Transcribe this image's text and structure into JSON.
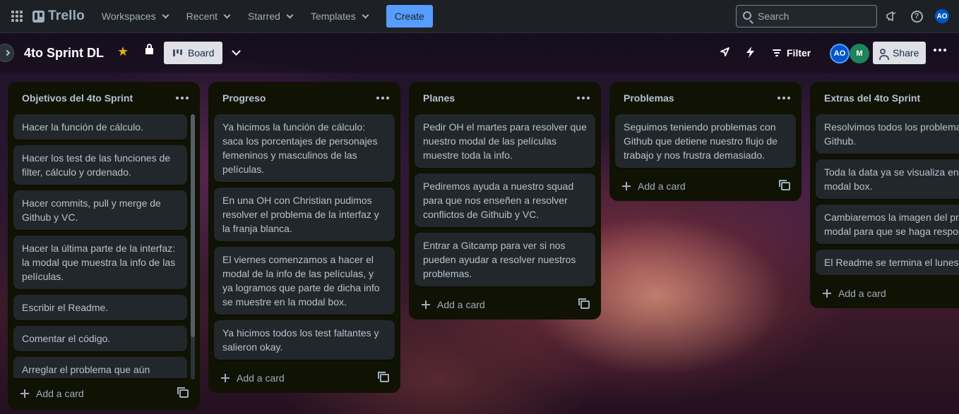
{
  "topbar": {
    "logo_text": "Trello",
    "nav": [
      "Workspaces",
      "Recent",
      "Starred",
      "Templates"
    ],
    "create_label": "Create",
    "search_placeholder": "Search",
    "user_initials": "AO"
  },
  "board": {
    "title": "4to Sprint DL",
    "view_label": "Board",
    "filter_label": "Filter",
    "members": [
      "AO",
      "M"
    ],
    "share_label": "Share"
  },
  "lists": [
    {
      "title": "Objetivos del 4to Sprint",
      "cards": [
        "Hacer la función de cálculo.",
        "Hacer los test de las funciones de filter, cálculo y ordenado.",
        "Hacer commits, pull y merge de Github y VC.",
        "Hacer la última parte de la interfaz: la modal que muestra la info de las películas.",
        "Escribir el Readme.",
        "Comentar el código.",
        "Arreglar el problema que aún"
      ],
      "add_label": "Add a card"
    },
    {
      "title": "Progreso",
      "cards": [
        "Ya hicimos la función de cálculo: saca los porcentajes de personajes femeninos y masculinos de las películas.",
        "En una OH con Christian pudimos resolver el problema de la interfaz y la franja blanca.",
        "El viernes comenzamos a hacer el modal de la info de las películas, y ya logramos que parte de dicha info se muestre en la modal box.",
        "Ya hicimos todos los test faltantes y salieron okay."
      ],
      "add_label": "Add a card"
    },
    {
      "title": "Planes",
      "cards": [
        "Pedir OH el martes para resolver que nuestro modal de las películas muestre toda la info.",
        "Pediremos ayuda a nuestro squad para que nos enseñen a resolver conflictos de Githuib y VC.",
        "Entrar a Gitcamp para ver si nos pueden ayudar a resolver nuestros problemas."
      ],
      "add_label": "Add a card"
    },
    {
      "title": "Problemas",
      "cards": [
        "Seguimos teniendo problemas con Github que detiene nuestro flujo de trabajo y nos frustra demasiado."
      ],
      "add_label": "Add a card"
    },
    {
      "title": "Extras del 4to Sprint",
      "cards": [
        "Resolvimos todos los problema Github.",
        "Toda la data ya se visualiza en l modal box.",
        "Cambiaremos la imagen del pri modal para que se haga respor",
        "El Readme se termina el lunes."
      ],
      "add_label": "Add a card"
    }
  ],
  "colors": {
    "topbar": "#1d2125",
    "list_bg": "#101204",
    "card_bg": "#22272b",
    "create_button": "#579dff",
    "star": "#e2b203",
    "avatar_ao": "#0055cc",
    "avatar_m": "#1f845a"
  },
  "icons": [
    "apps-grid-icon",
    "trello-logo-icon",
    "search-icon",
    "megaphone-icon",
    "help-icon",
    "star-icon",
    "lock-icon",
    "board-icon",
    "rocket-icon",
    "automation-bolt-icon",
    "filter-icon",
    "share-icon",
    "more-icon",
    "plus-icon",
    "card-template-icon"
  ]
}
